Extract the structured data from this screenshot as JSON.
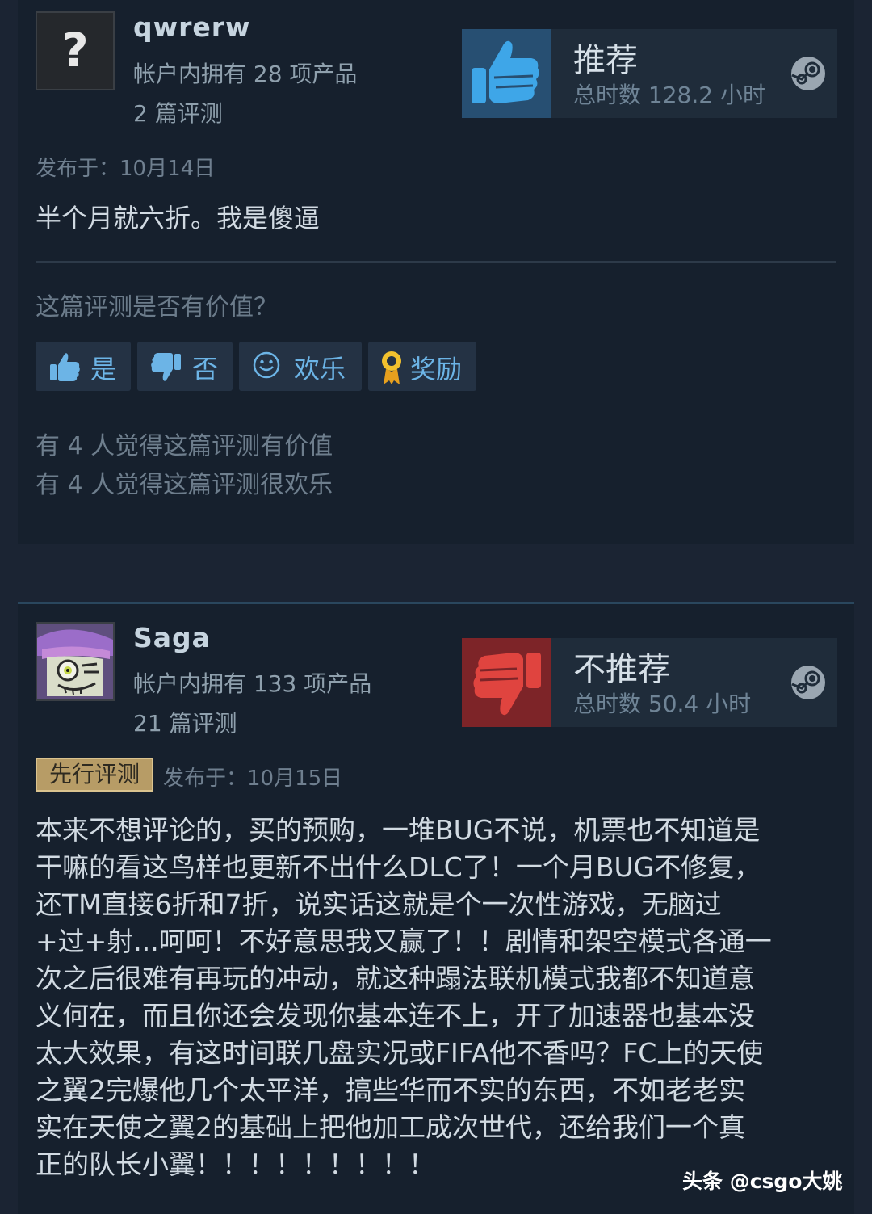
{
  "reviews": [
    {
      "username": "qwrerw",
      "avatar_icon": "question-mark-icon",
      "avatar_glyph": "?",
      "products": "帐户内拥有 28 项产品",
      "review_count": "2 篇评测",
      "recommendation": "推荐",
      "hours": "总时数 128.2 小时",
      "posted": "发布于：10月14日",
      "text": "半个月就六折。我是傻逼",
      "helpful_question": "这篇评测是否有价值？",
      "buttons": {
        "yes": "是",
        "no": "否",
        "funny": "欢乐",
        "award": "奖励"
      },
      "helpful_count": "有 4 人觉得这篇评测有价值",
      "funny_count": "有 4 人觉得这篇评测很欢乐"
    },
    {
      "username": "Saga",
      "products": "帐户内拥有 133 项产品",
      "review_count": "21 篇评测",
      "recommendation": "不推荐",
      "hours": "总时数 50.4 小时",
      "badge": "先行评测",
      "posted": "发布于：10月15日",
      "text": "本来不想评论的，买的预购，一堆BUG不说，机票也不知道是干嘛的看这鸟样也更新不出什么DLC了！一个月BUG不修复，还TM直接6折和7折，说实话这就是个一次性游戏，无脑过+过+射...呵呵！不好意思我又赢了！！剧情和架空模式各通一次之后很难有再玩的冲动，就这种蹋法联机模式我都不知道意义何在，而且你还会发现你基本连不上，开了加速器也基本没太大效果，有这时间联几盘实况或FIFA他不香吗？FC上的天使之翼2完爆他几个太平洋，搞些华而不实的东西，不如老老实实在天使之翼2的基础上把他加工成次世代，还给我们一个真正的队长小翼！！！！！！！！！",
      "text_lines": [
        "本来不想评论的，买的预购，一堆BUG不说，机票也不知道是",
        "干嘛的看这鸟样也更新不出什么DLC了！一个月BUG不修复，",
        "还TM直接6折和7折，说实话这就是个一次性游戏，无脑过",
        "+过+射...呵呵！不好意思我又赢了！！剧情和架空模式各通一",
        "次之后很难有再玩的冲动，就这种蹋法联机模式我都不知道意",
        "义何在，而且你还会发现你基本连不上，开了加速器也基本没",
        "太大效果，有这时间联几盘实况或FIFA他不香吗？FC上的天使",
        "之翼2完爆他几个太平洋，搞些华而不实的东西，不如老老实",
        "实在天使之翼2的基础上把他加工成次世代，还给我们一个真",
        "正的队长小翼！！！！！！！！！"
      ]
    }
  ],
  "icons": {
    "thumbs_up": "thumbs-up-icon",
    "thumbs_down": "thumbs-down-icon",
    "steam": "steam-logo-icon",
    "smiley": "smiley-icon",
    "award": "award-ribbon-icon"
  },
  "colors": {
    "recommend": "#3ea6e8",
    "not_recommend": "#e0443f",
    "button_text": "#6cb4e6",
    "badge_bg": "#b79c66",
    "award_gold": "#f2c12e"
  },
  "watermark": "头条 @csgo大姚"
}
